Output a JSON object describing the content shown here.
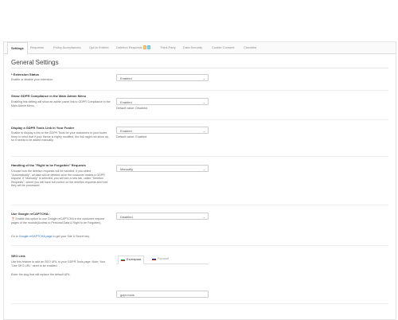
{
  "tabs": [
    {
      "label": "Settings",
      "active": true
    },
    {
      "label": "Requests"
    },
    {
      "label": "Policy Acceptances"
    },
    {
      "label": "Opt-in Entries"
    },
    {
      "label": "Deletion Requests",
      "badges": [
        "0",
        "0"
      ]
    },
    {
      "label": "Third-Party"
    },
    {
      "label": "Data Security"
    },
    {
      "label": "Cookie Consent"
    },
    {
      "label": "Checklist"
    }
  ],
  "badge_colors": [
    "#f0ad4e",
    "#5bc0de"
  ],
  "section_title": "General Settings",
  "rows": {
    "extension_status": {
      "label": "* Extension Status",
      "desc": "Enable or disable your extension.",
      "value": "Enabled"
    },
    "show_gdpr": {
      "label": "Show GDPR Compliance in the Main Admin Menu",
      "desc": "Enabling this setting will show an admin panel link to GDPR Compliance in the Main Admin Menu.",
      "value": "Enabled",
      "note": "Default value: Disabled"
    },
    "display_footer": {
      "label": "Display a GDPR Tools Link in Your Footer",
      "desc": "Enable to display a link to the GDPR Tools for your customers in your footer. Keep in mind that if your theme is highly modified, the link might not show up, so it needs to be added manually.",
      "value": "Enabled",
      "note": "Default value: Enabled"
    },
    "forgotten": {
      "label": "Handling of the \"Right to be Forgotten\" Requests",
      "desc": "Choose how the deletion requests will be handled. If you select \"Automatically\", all data will be deleted once the customer makes a GDPR request. If \"Manually\" is selected, you will see a new tab, called \"Deletion Requests\", where you will have full control on the deletion requests and how they will be processed.",
      "value": "Manually"
    },
    "recaptcha": {
      "label": "Use Google reCAPTCHA:",
      "desc": "❓ Enable this option to use Google reCAPTCHA in the customer request pages of the module(Access to Personal Data & Right to be Forgotten).",
      "link_prefix": "Go to ",
      "link_text": "Google reCAPTCHA page",
      "link_suffix": " to get your Site & Secret key.",
      "value": "Disabled"
    },
    "seo": {
      "label": "SEO Link",
      "desc": "Use this feature to add an SEO URL to your GDPR Tools page. Note: Your \"Use SEO URL\" need to be enabled.",
      "desc2": "Enter the slug that will replace the default URL.",
      "languages": [
        "Български",
        "Pyccкий"
      ],
      "value": "gdpr-tools"
    }
  }
}
